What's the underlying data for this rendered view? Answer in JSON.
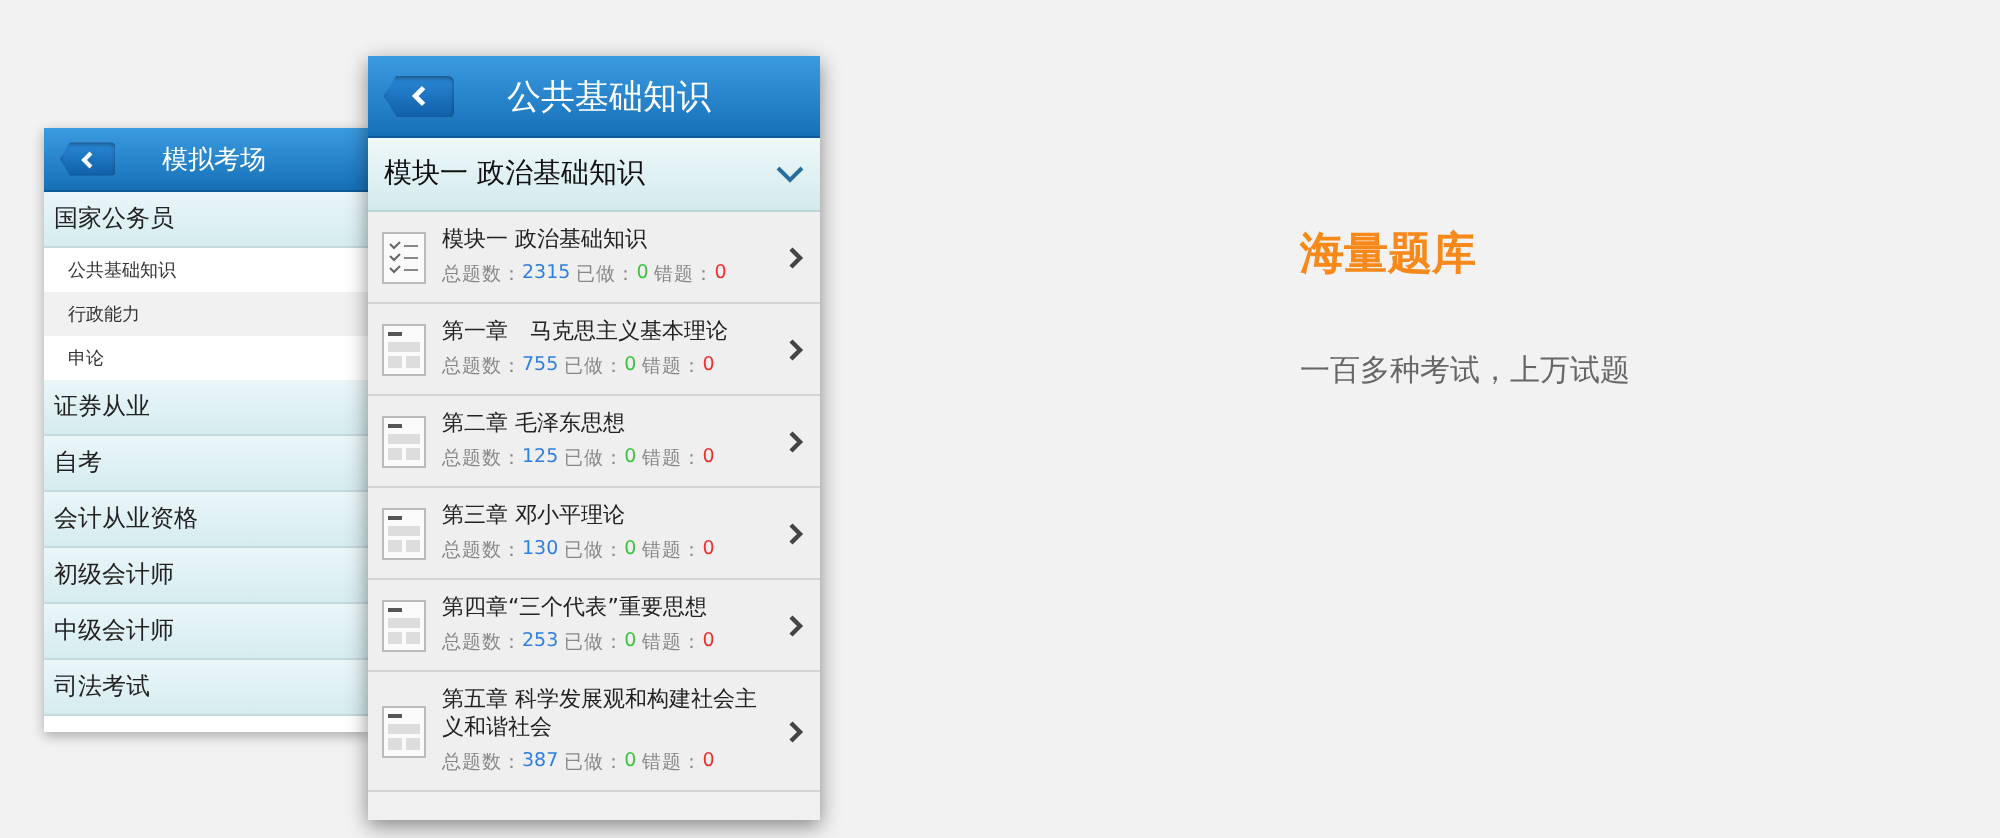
{
  "back_screen": {
    "title": "模拟考场",
    "categories": [
      {
        "label": "国家公务员",
        "children": [
          {
            "label": "公共基础知识"
          },
          {
            "label": "行政能力"
          },
          {
            "label": "申论"
          }
        ]
      },
      {
        "label": "证券从业"
      },
      {
        "label": "自考"
      },
      {
        "label": "会计从业资格"
      },
      {
        "label": "初级会计师"
      },
      {
        "label": "中级会计师"
      },
      {
        "label": "司法考试"
      }
    ]
  },
  "front_screen": {
    "title": "公共基础知识",
    "module": {
      "label": "模块一 政治基础知识"
    },
    "items": [
      {
        "kind": "checklist",
        "title": "模块一 政治基础知识",
        "total_label": "总题数：",
        "total": "2315",
        "done_label": "已做：",
        "done": "0",
        "wrong_label": "错题：",
        "wrong": "0"
      },
      {
        "kind": "chapter",
        "title": "第一章　马克思主义基本理论",
        "total_label": "总题数：",
        "total": "755",
        "done_label": "已做：",
        "done": "0",
        "wrong_label": "错题：",
        "wrong": "0"
      },
      {
        "kind": "chapter",
        "title": "第二章 毛泽东思想",
        "total_label": "总题数：",
        "total": "125",
        "done_label": "已做：",
        "done": "0",
        "wrong_label": "错题：",
        "wrong": "0"
      },
      {
        "kind": "chapter",
        "title": "第三章 邓小平理论",
        "total_label": "总题数：",
        "total": "130",
        "done_label": "已做：",
        "done": "0",
        "wrong_label": "错题：",
        "wrong": "0"
      },
      {
        "kind": "chapter",
        "title": "第四章“三个代表”重要思想",
        "total_label": "总题数：",
        "total": "253",
        "done_label": "已做：",
        "done": "0",
        "wrong_label": "错题：",
        "wrong": "0"
      },
      {
        "kind": "chapter",
        "title": "第五章 科学发展观和构建社会主义和谐社会",
        "total_label": "总题数：",
        "total": "387",
        "done_label": "已做：",
        "done": "0",
        "wrong_label": "错题：",
        "wrong": "0"
      }
    ]
  },
  "feature": {
    "heading": "海量题库",
    "description": "一百多种考试，上万试题"
  }
}
